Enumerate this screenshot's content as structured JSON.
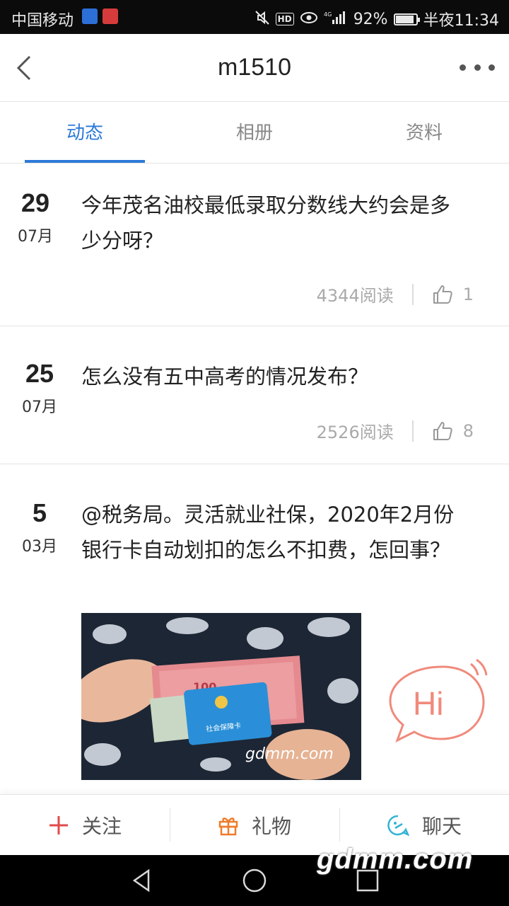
{
  "status_bar": {
    "carrier": "中国移动",
    "badge1": "",
    "badge2": "",
    "network": "4G",
    "battery": "92%",
    "battery_level": 0.92,
    "time": "半夜11:34"
  },
  "header": {
    "title": "m1510"
  },
  "tabs": [
    {
      "label": "动态",
      "active": true
    },
    {
      "label": "相册",
      "active": false
    },
    {
      "label": "资料",
      "active": false
    }
  ],
  "posts": [
    {
      "day": "29",
      "month": "07月",
      "text": "今年茂名油校最低录取分数线大约会是多少分呀？",
      "reads": "4344阅读",
      "likes": "1"
    },
    {
      "day": "25",
      "month": "07月",
      "text": "怎么没有五中高考的情况发布？",
      "reads": "2526阅读",
      "likes": "8"
    },
    {
      "day": "5",
      "month": "03月",
      "text": "@税务局。灵活就业社保，2020年2月份银行卡自动划扣的怎么不扣费，怎回事？",
      "image_caption": "gdmm.com",
      "image_labels": {
        "banknote": "100",
        "card": "社会保障卡"
      }
    }
  ],
  "hi_button": {
    "label": "Hi",
    "color": "#f08a7c"
  },
  "actions": [
    {
      "label": "关注",
      "icon": "plus-icon",
      "color": "#e04b4b"
    },
    {
      "label": "礼物",
      "icon": "gift-icon",
      "color": "#f07b2a"
    },
    {
      "label": "聊天",
      "icon": "chat-icon",
      "color": "#33b3d6"
    }
  ],
  "watermark": "gdmm.com",
  "colors": {
    "accent": "#2d7ad8"
  }
}
